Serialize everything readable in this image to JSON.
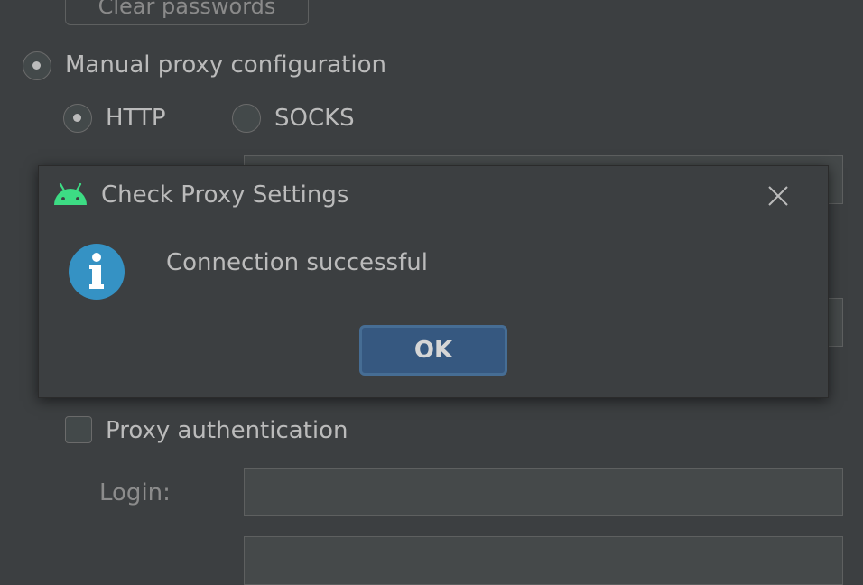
{
  "background": {
    "clear_passwords_label": "Clear passwords",
    "manual_proxy_label": "Manual proxy configuration",
    "http_label": "HTTP",
    "socks_label": "SOCKS",
    "proxy_auth_label": "Proxy authentication",
    "login_label": "Login:"
  },
  "dialog": {
    "title": "Check Proxy Settings",
    "message": "Connection successful",
    "ok_label": "OK",
    "icons": {
      "app": "android-icon",
      "close": "close-icon",
      "info": "info-icon"
    }
  },
  "colors": {
    "background": "#3c3f41",
    "text": "#bbbbbb",
    "accent_button": "#365880",
    "info_icon": "#3592c4",
    "android_green": "#3ddc84"
  }
}
